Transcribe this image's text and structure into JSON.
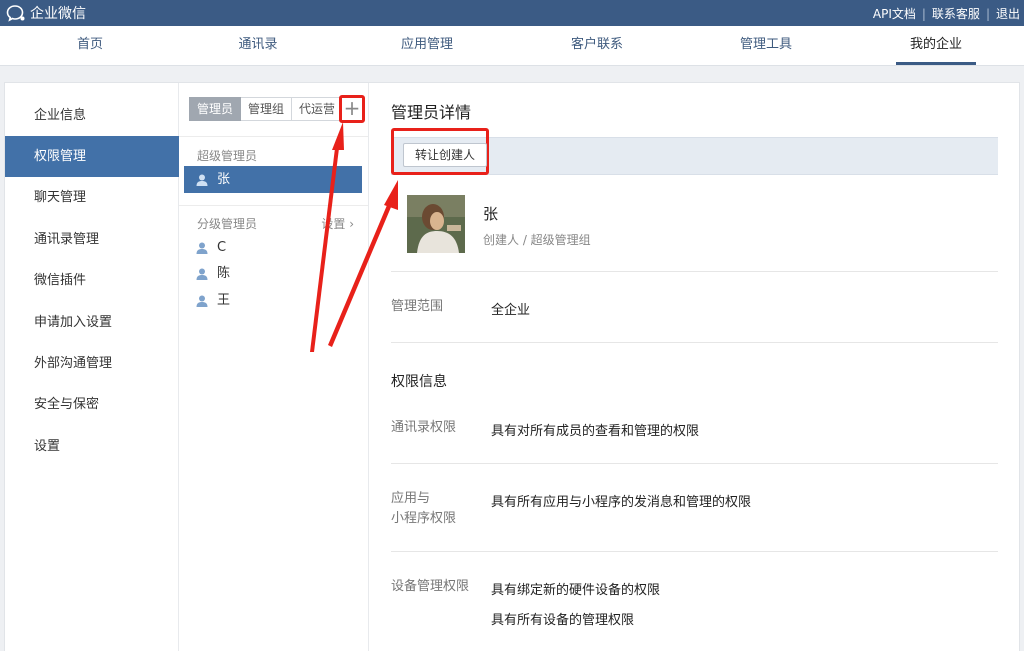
{
  "header": {
    "brand": "企业微信",
    "links": [
      "API文档",
      "联系客服",
      "退出"
    ]
  },
  "nav": {
    "items": [
      "首页",
      "通讯录",
      "应用管理",
      "客户联系",
      "管理工具",
      "我的企业"
    ],
    "active_index": 5
  },
  "sidebar": {
    "items": [
      "企业信息",
      "权限管理",
      "聊天管理",
      "通讯录管理",
      "微信插件",
      "申请加入设置",
      "外部沟通管理",
      "安全与保密",
      "设置"
    ],
    "active_index": 1
  },
  "admin_list": {
    "tabs": [
      "管理员",
      "管理组",
      "代运营"
    ],
    "add_label": "+",
    "super_admin_label": "超级管理员",
    "super_admins": [
      "张"
    ],
    "sub_admin_label": "分级管理员",
    "settings_label": "设置 ›",
    "sub_admins": [
      "C",
      "陈",
      "王"
    ]
  },
  "detail": {
    "title": "管理员详情",
    "transfer_button": "转让创建人",
    "user_name": "张",
    "user_role": "创建人 / 超级管理组",
    "scope_label": "管理范围",
    "scope_value": "全企业",
    "permissions_title": "权限信息",
    "contacts_label": "通讯录权限",
    "contacts_value": "具有对所有成员的查看和管理的权限",
    "apps_label_1": "应用与",
    "apps_label_2": "小程序权限",
    "apps_value": "具有所有应用与小程序的发消息和管理的权限",
    "devices_label": "设备管理权限",
    "devices_value_1": "具有绑定新的硬件设备的权限",
    "devices_value_2": "具有所有设备的管理权限"
  },
  "colors": {
    "header_bg": "#3b5b85",
    "selected_bg": "#4271a8",
    "highlight_red": "#e8211a"
  }
}
